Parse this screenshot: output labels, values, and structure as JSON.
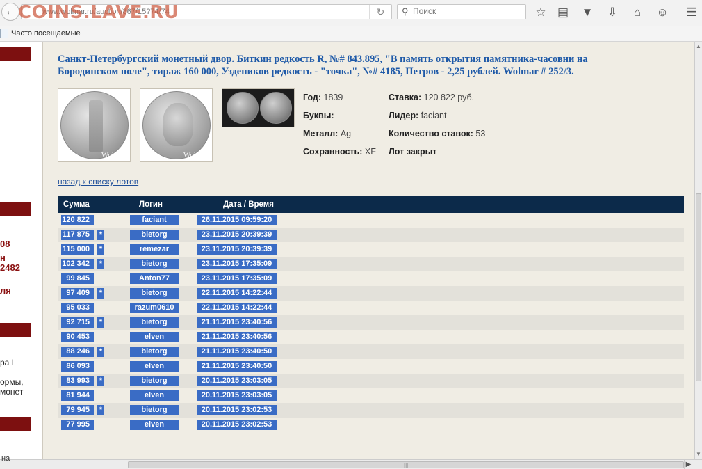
{
  "browser": {
    "url": "www.wolmar.ru/auction/867/15?74/74",
    "search_placeholder": "Поиск",
    "site_logo": "COINS.LAVE.RU",
    "bookmark_label": "Часто посещаемые",
    "toolbar_icons": [
      "star-icon",
      "reading-list-icon",
      "pocket-icon",
      "download-icon",
      "home-icon",
      "chat-icon",
      "menu-icon"
    ]
  },
  "leftcol": {
    "texts": [
      "08",
      "н",
      "2482",
      "ля",
      "ра I",
      "ормы,",
      " монет"
    ],
    "bottom_text": "на"
  },
  "lot": {
    "title": "Санкт-Петербургский монетный двор. Биткин редкость R, №# 843.895, \"В память открытия памятника-часовни на Бородинском поле\", тираж 160 000, Уздеников редкость - \"точка\", №# 4185, Петров - 2,25 рублей. Wolmar # 252/3.",
    "watermark": "Wolmar",
    "info_left": [
      {
        "label": "Год:",
        "value": "1839"
      },
      {
        "label": "Буквы:",
        "value": ""
      },
      {
        "label": "Металл:",
        "value": "Ag"
      },
      {
        "label": "Сохранность:",
        "value": "XF"
      }
    ],
    "info_right": [
      {
        "label": "Ставка:",
        "value": "120 822 руб."
      },
      {
        "label": "Лидер:",
        "value": "faciant"
      },
      {
        "label": "Количество ставок:",
        "value": "53"
      },
      {
        "label": "Лот закрыт",
        "value": ""
      }
    ],
    "back_link": "назад к списку лотов"
  },
  "bids": {
    "headers": {
      "sum": "Сумма",
      "login": "Логин",
      "date": "Дата / Время"
    },
    "rows": [
      {
        "sum": "120 822",
        "star": "",
        "login": "faciant",
        "date": "26.11.2015 09:59:20"
      },
      {
        "sum": "117 875",
        "star": "*",
        "login": "bietorg",
        "date": "23.11.2015 20:39:39"
      },
      {
        "sum": "115 000",
        "star": "*",
        "login": "remezar",
        "date": "23.11.2015 20:39:39"
      },
      {
        "sum": "102 342",
        "star": "*",
        "login": "bietorg",
        "date": "23.11.2015 17:35:09"
      },
      {
        "sum": "99 845",
        "star": "",
        "login": "Anton77",
        "date": "23.11.2015 17:35:09"
      },
      {
        "sum": "97 409",
        "star": "*",
        "login": "bietorg",
        "date": "22.11.2015 14:22:44"
      },
      {
        "sum": "95 033",
        "star": "",
        "login": "razum0610",
        "date": "22.11.2015 14:22:44"
      },
      {
        "sum": "92 715",
        "star": "*",
        "login": "bietorg",
        "date": "21.11.2015 23:40:56"
      },
      {
        "sum": "90 453",
        "star": "",
        "login": "elven",
        "date": "21.11.2015 23:40:56"
      },
      {
        "sum": "88 246",
        "star": "*",
        "login": "bietorg",
        "date": "21.11.2015 23:40:50"
      },
      {
        "sum": "86 093",
        "star": "",
        "login": "elven",
        "date": "21.11.2015 23:40:50"
      },
      {
        "sum": "83 993",
        "star": "*",
        "login": "bietorg",
        "date": "20.11.2015 23:03:05"
      },
      {
        "sum": "81 944",
        "star": "",
        "login": "elven",
        "date": "20.11.2015 23:03:05"
      },
      {
        "sum": "79 945",
        "star": "*",
        "login": "bietorg",
        "date": "20.11.2015 23:02:53"
      },
      {
        "sum": "77 995",
        "star": "",
        "login": "elven",
        "date": "20.11.2015 23:02:53"
      }
    ]
  }
}
